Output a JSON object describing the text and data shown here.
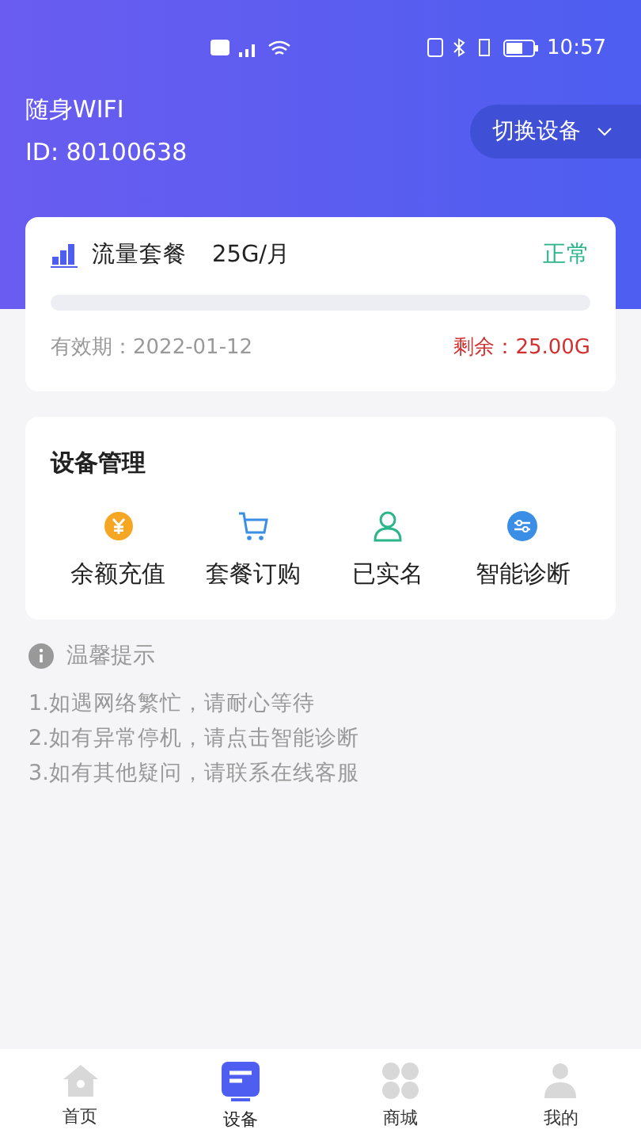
{
  "status_bar": {
    "time": "10:57"
  },
  "device": {
    "name": "随身WIFI",
    "id": "ID:  80100638",
    "switch_label": "切换设备"
  },
  "plan": {
    "title": "流量套餐",
    "quota": "25G/月",
    "status": "正常",
    "level": 0,
    "validity": "有效期：2022-01-12",
    "remaining": "剩余：25.00G"
  },
  "management": {
    "title": "设备管理",
    "items": [
      {
        "kind": "recharge",
        "label": "余额充值"
      },
      {
        "kind": "cart",
        "label": "套餐订购"
      },
      {
        "kind": "person",
        "label": "已实名"
      },
      {
        "kind": "diagnose",
        "label": "智能诊断"
      }
    ]
  },
  "tips": {
    "title": "温馨提示",
    "lines": [
      "1.如遇网络繁忙，请耐心等待",
      "2.如有异常停机，请点击智能诊断",
      "3.如有其他疑问，请联系在线客服"
    ]
  },
  "tab_bar": [
    {
      "kind": "home",
      "label": "首页",
      "selected": false
    },
    {
      "kind": "device",
      "label": "设备",
      "selected": true
    },
    {
      "kind": "shop",
      "label": "商城",
      "selected": false
    },
    {
      "kind": "me",
      "label": "我的",
      "selected": false
    }
  ]
}
